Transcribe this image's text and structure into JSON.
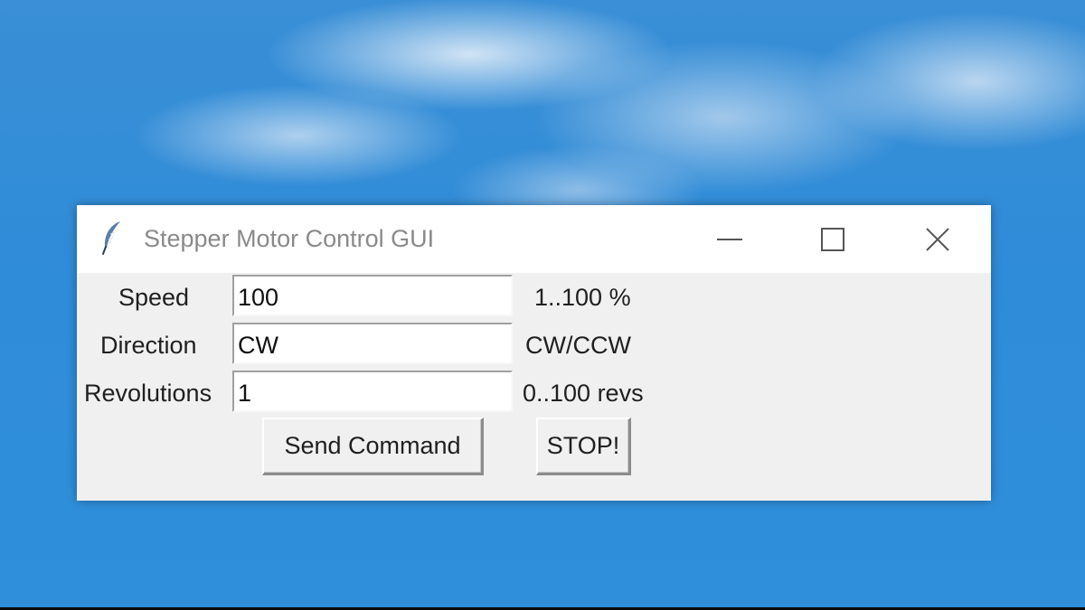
{
  "window": {
    "title": "Stepper Motor Control GUI",
    "icon": "feather-icon",
    "controls": {
      "minimize_icon": "minimize-icon",
      "maximize_icon": "maximize-icon",
      "close_icon": "close-icon"
    }
  },
  "form": {
    "speed": {
      "label": "Speed",
      "value": "100",
      "hint": "1..100 %"
    },
    "direction": {
      "label": "Direction",
      "value": "CW",
      "hint": "CW/CCW"
    },
    "revolutions": {
      "label": "Revolutions",
      "value": "1",
      "hint": "0..100 revs"
    }
  },
  "buttons": {
    "send": "Send Command",
    "stop": "STOP!"
  },
  "colors": {
    "desktop_blue": "#2f8cd8",
    "window_bg": "#f0f0f0",
    "titlebar_bg": "#ffffff",
    "title_text": "#8a8a8a"
  }
}
